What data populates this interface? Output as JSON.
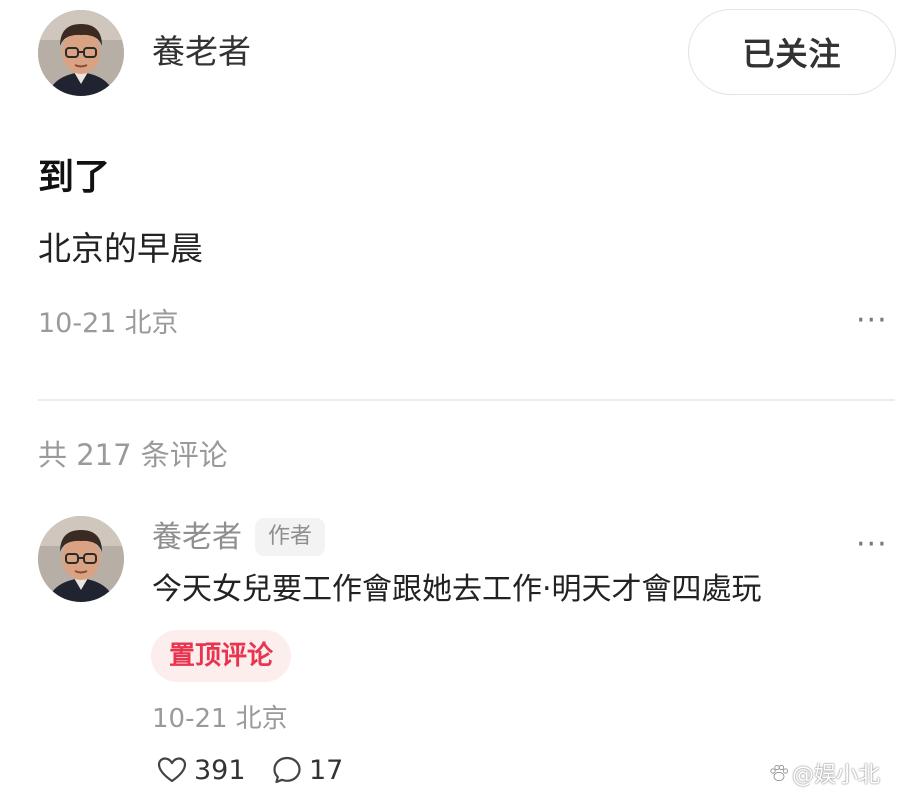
{
  "post": {
    "author": {
      "name": "養老者",
      "avatar_icon": "user-avatar-icon"
    },
    "follow_button_label": "已关注",
    "title": "到了",
    "body": "北京的早晨",
    "date": "10-21",
    "location": "北京",
    "more_icon": "more-horizontal-icon",
    "more_label": "···"
  },
  "comments_section": {
    "count_label": "共 217 条评论",
    "comments": [
      {
        "author": "養老者",
        "author_badge": "作者",
        "avatar_icon": "user-avatar-icon",
        "text": "今天女兒要工作會跟她去工作‧明天才會四處玩",
        "pinned_label": "置顶评论",
        "date": "10-21",
        "location": "北京",
        "more_label": "···",
        "likes": "391",
        "like_icon": "heart-icon",
        "replies": "17",
        "reply_icon": "comment-bubble-icon"
      }
    ]
  },
  "watermark": {
    "text": "@娱小北",
    "icon": "paw-icon"
  },
  "colors": {
    "accent_red": "#e8344e",
    "pinned_bg": "#fdeeee",
    "muted_text": "#9a9a9a",
    "divider": "#ececec"
  }
}
